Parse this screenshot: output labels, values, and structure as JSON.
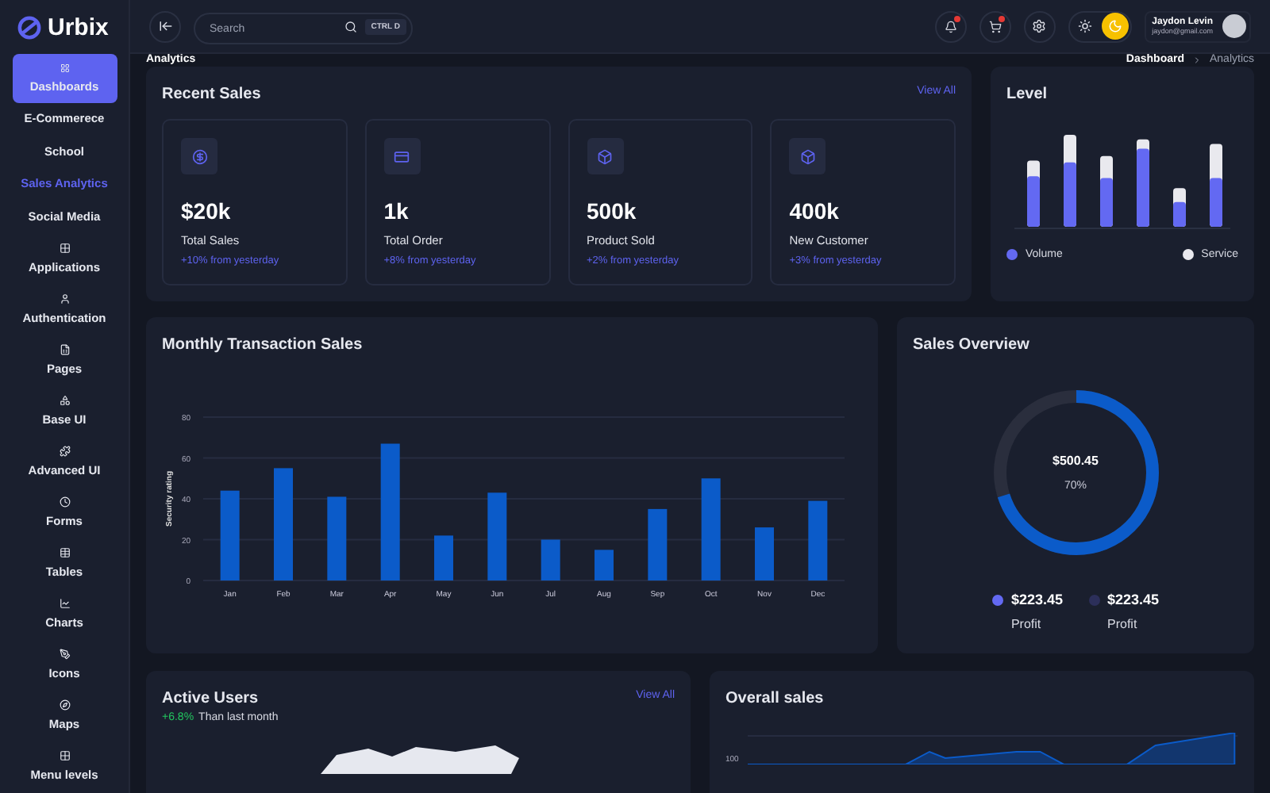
{
  "brand": {
    "name": "Urbix"
  },
  "sidebar": {
    "items": [
      {
        "label": "Dashboards",
        "selected": true,
        "children": [
          {
            "label": "E-Commerece",
            "selected": false
          },
          {
            "label": "School",
            "selected": false
          },
          {
            "label": "Sales Analytics",
            "selected": true
          },
          {
            "label": "Social Media",
            "selected": false
          }
        ]
      },
      {
        "label": "Applications",
        "selected": false
      },
      {
        "label": "Authentication",
        "selected": false
      },
      {
        "label": "Pages",
        "selected": false
      },
      {
        "label": "Base UI",
        "selected": false
      },
      {
        "label": "Advanced UI",
        "selected": false
      },
      {
        "label": "Forms",
        "selected": false
      },
      {
        "label": "Tables",
        "selected": false
      },
      {
        "label": "Charts",
        "selected": false
      },
      {
        "label": "Icons",
        "selected": false
      },
      {
        "label": "Maps",
        "selected": false
      },
      {
        "label": "Menu levels",
        "selected": false
      }
    ]
  },
  "header": {
    "search": {
      "placeholder": "Search",
      "shortcut": "CTRL D"
    },
    "notifications_badge": true,
    "cart_badge": true,
    "dark_mode": true,
    "user": {
      "name": "Jaydon Levin",
      "email": "jaydon@gmail.com"
    }
  },
  "page_title": "Analytics",
  "breadcrumb": [
    {
      "label": "Dashboard",
      "selected": false
    },
    {
      "label": "Analytics",
      "selected": true
    }
  ],
  "recent_sales": {
    "title": "Recent Sales",
    "link": "View All",
    "stats": [
      {
        "value": "$20k",
        "label": "Total Sales",
        "change": "+10% from yesterday"
      },
      {
        "value": "1k",
        "label": "Total Order",
        "change": "+8% from yesterday"
      },
      {
        "value": "500k",
        "label": "Product Sold",
        "change": "+2% from yesterday"
      },
      {
        "value": "400k",
        "label": "New Customer",
        "change": "+3% from yesterday"
      }
    ]
  },
  "level": {
    "title": "Level",
    "legend": [
      {
        "label": "Volume",
        "color": "#6369f2"
      },
      {
        "label": "Service",
        "color": "#e9e9ee"
      }
    ]
  },
  "monthly_sales": {
    "title": "Monthly Transaction Sales",
    "chart_data": {
      "type": "bar",
      "ylabel": "Security rating",
      "categories": [
        "Jan",
        "Feb",
        "Mar",
        "Apr",
        "May",
        "Jun",
        "Jul",
        "Aug",
        "Sep",
        "Oct",
        "Nov",
        "Dec"
      ],
      "values": [
        44,
        55,
        41,
        67,
        22,
        43,
        20,
        15,
        35,
        50,
        26,
        39
      ],
      "ylim": [
        0,
        80
      ],
      "yticks": [
        0,
        20,
        40,
        60,
        80
      ],
      "grid": true
    }
  },
  "sales_overview": {
    "title": "Sales Overview",
    "total": "$500.45",
    "percent": "70%",
    "level": 0.7,
    "legend": [
      {
        "value": "$223.45",
        "label": "Profit",
        "color": "#6369f2"
      },
      {
        "value": "$223.45",
        "label": "Profit",
        "color": "#2c2f5a"
      }
    ]
  },
  "active_users": {
    "title": "Active Users",
    "change": "+6.8%",
    "note": "Than last month",
    "link": "View All"
  },
  "overall_sales": {
    "title": "Overall sales",
    "ytick": "100"
  }
}
